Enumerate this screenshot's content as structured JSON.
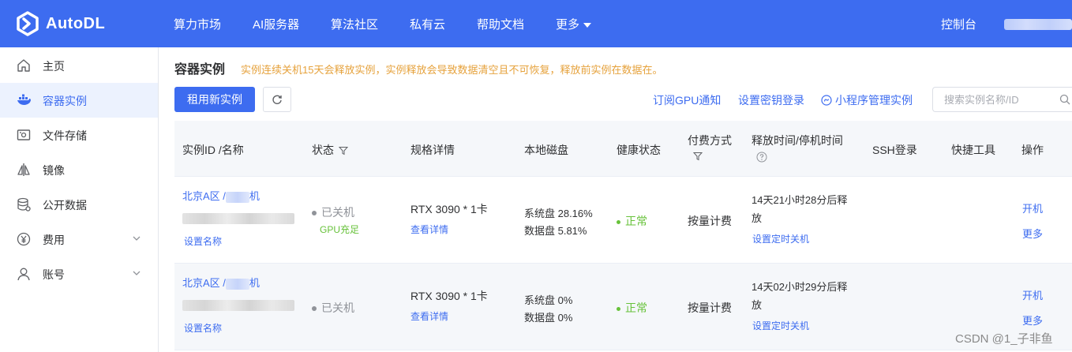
{
  "brand": {
    "name": "AutoDL"
  },
  "nav": {
    "items": [
      "算力市场",
      "AI服务器",
      "算法社区",
      "私有云",
      "帮助文档"
    ],
    "more": "更多",
    "console": "控制台"
  },
  "sidebar": {
    "items": [
      {
        "label": "主页",
        "icon": "home-icon"
      },
      {
        "label": "容器实例",
        "icon": "container-icon"
      },
      {
        "label": "文件存储",
        "icon": "storage-icon"
      },
      {
        "label": "镜像",
        "icon": "image-icon"
      },
      {
        "label": "公开数据",
        "icon": "database-icon"
      },
      {
        "label": "费用",
        "icon": "yen-icon"
      },
      {
        "label": "账号",
        "icon": "user-icon"
      }
    ],
    "active": "容器实例"
  },
  "page": {
    "title": "容器实例",
    "notice": "实例连续关机15天会释放实例，实例释放会导致数据清空且不可恢复，释放前实例在数据在。",
    "new_instance": "租用新实例",
    "subscribe": "订阅GPU通知",
    "ssh_key": "设置密钥登录",
    "miniapp": "小程序管理实例",
    "search_placeholder": "搜索实例名称/ID"
  },
  "table": {
    "headers": {
      "id": "实例ID /名称",
      "status": "状态",
      "spec": "规格详情",
      "disk": "本地磁盘",
      "health": "健康状态",
      "billing": "付费方式",
      "release": "释放时间/停机时间",
      "ssh": "SSH登录",
      "tools": "快捷工具",
      "ops": "操作"
    },
    "rows": [
      {
        "region": "北京A区 /",
        "name_suffix": "机",
        "set_name": "设置名称",
        "status": "已关机",
        "gpu_note": "GPU充足",
        "spec": "RTX 3090 * 1卡",
        "spec_link": "查看详情",
        "sys_disk": "系统盘 28.16%",
        "data_disk": "数据盘 5.81%",
        "health": "正常",
        "billing": "按量计费",
        "release_line1": "14天21小时28分后释",
        "release_line2": "放",
        "release_link": "设置定时关机",
        "op_start": "开机",
        "op_more": "更多"
      },
      {
        "region": "北京A区 /",
        "name_suffix": "机",
        "set_name": "设置名称",
        "status": "已关机",
        "gpu_note": "",
        "spec": "RTX 3090 * 1卡",
        "spec_link": "查看详情",
        "sys_disk": "系统盘 0%",
        "data_disk": "数据盘 0%",
        "health": "正常",
        "billing": "按量计费",
        "release_line1": "14天02小时29分后释",
        "release_line2": "放",
        "release_link": "设置定时关机",
        "op_start": "开机",
        "op_more": "更多"
      }
    ]
  },
  "watermark": "CSDN @1_子非鱼",
  "colors": {
    "primary": "#3d6cf0",
    "warning": "#e6a23c",
    "success": "#67c23a",
    "muted": "#909399"
  }
}
